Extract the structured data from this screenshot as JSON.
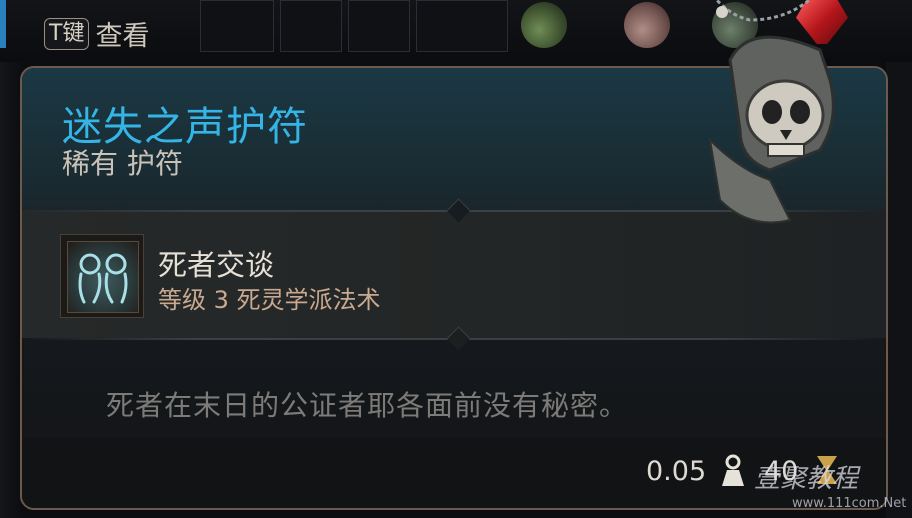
{
  "top_bar": {
    "key_hint": {
      "key": "T键",
      "label": "查看"
    },
    "potions": [
      {
        "name": "green-potion-icon",
        "color": "#4d6b3a"
      },
      {
        "name": "pink-potion-icon",
        "color": "#8f6a66"
      },
      {
        "name": "dark-potion-icon",
        "color": "#4a5a4a"
      },
      {
        "name": "red-gem-icon",
        "color": "#c21f24"
      }
    ]
  },
  "item": {
    "name": "迷失之声护符",
    "subtitle": "稀有 护符",
    "name_color": "#35b4e6",
    "skill": {
      "icon": "twin-ghosts-icon",
      "name": "死者交谈",
      "level_text": "等级 3 死灵学派法术"
    },
    "flavor_text": "死者在末日的公证者耶各面前没有秘密。",
    "weight": "0.05",
    "weight_icon": "weight-icon",
    "value": "40",
    "value_icon": "hourglass-icon"
  },
  "watermark": {
    "text": "壹聚教程",
    "url": "www.111com.Net"
  }
}
